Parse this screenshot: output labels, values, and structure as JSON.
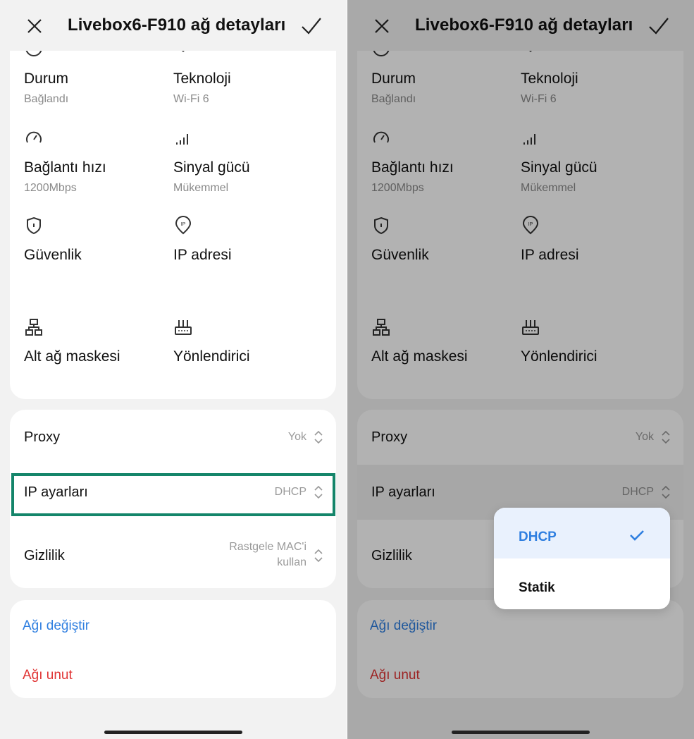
{
  "header": {
    "title": "Livebox6-F910 ağ detayları",
    "close_icon": "close-icon",
    "confirm_icon": "checkmark-icon"
  },
  "network_info": [
    {
      "id": "status",
      "icon": "info-icon",
      "label": "Durum",
      "value": "Bağlandı"
    },
    {
      "id": "technology",
      "icon": "wifi-icon",
      "label": "Teknoloji",
      "value": "Wi-Fi 6"
    },
    {
      "id": "link-speed",
      "icon": "speedometer-icon",
      "label": "Bağlantı hızı",
      "value": "1200Mbps"
    },
    {
      "id": "signal",
      "icon": "signal-bars-icon",
      "label": "Sinyal gücü",
      "value": "Mükemmel"
    },
    {
      "id": "security",
      "icon": "shield-icon",
      "label": "Güvenlik",
      "value": ""
    },
    {
      "id": "ip-address",
      "icon": "ip-pin-icon",
      "label": "IP adresi",
      "value": ""
    },
    {
      "id": "subnet",
      "icon": "network-tree-icon",
      "label": "Alt ağ maskesi",
      "value": ""
    },
    {
      "id": "router",
      "icon": "router-icon",
      "label": "Yönlendirici",
      "value": ""
    }
  ],
  "settings": {
    "proxy": {
      "label": "Proxy",
      "value": "Yok"
    },
    "ip_settings": {
      "label": "IP ayarları",
      "value": "DHCP"
    },
    "privacy": {
      "label": "Gizlilik",
      "value_line1": "Rastgele MAC'i",
      "value_line2": "kullan"
    }
  },
  "actions": {
    "change_network": "Ağı değiştir",
    "forget_network": "Ağı unut"
  },
  "popup": {
    "options": [
      "DHCP",
      "Statik"
    ],
    "selected": "DHCP"
  },
  "colors": {
    "accent_blue": "#2f7fe0",
    "danger_red": "#e03434",
    "highlight_green": "#14856a"
  }
}
